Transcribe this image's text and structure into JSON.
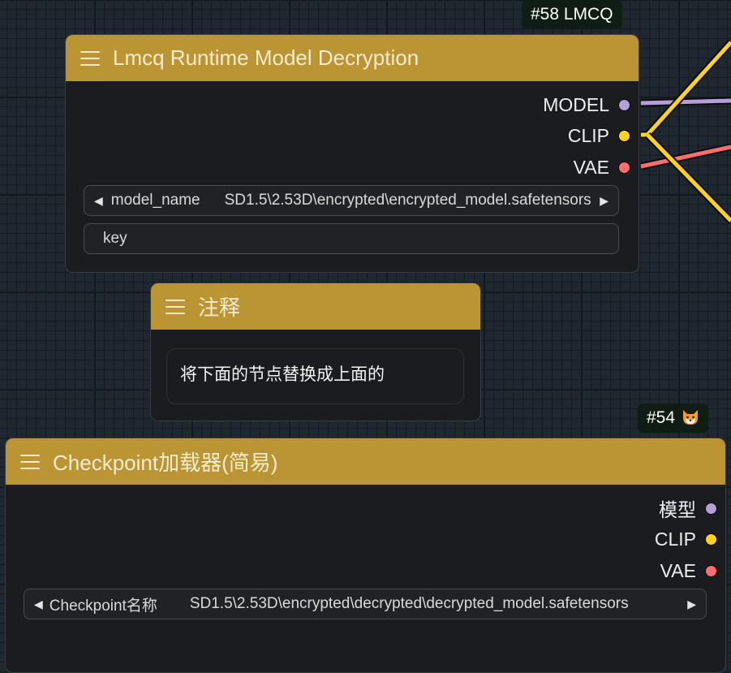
{
  "colors": {
    "header": "#bb9434",
    "node_body": "#1b1c20",
    "model_slot": "#b49fd6",
    "clip_slot": "#ffd21f",
    "vae_slot": "#ff6e6e",
    "badge_bg": "#0f1d14"
  },
  "lmcq_node": {
    "badge": "#58 LMCQ",
    "title": "Lmcq Runtime Model Decryption",
    "menu_icon": "hamburger-icon",
    "outputs": [
      {
        "label": "MODEL",
        "color": "#b49fd6"
      },
      {
        "label": "CLIP",
        "color": "#ffd21f"
      },
      {
        "label": "VAE",
        "color": "#ff6e6e"
      }
    ],
    "model_widget": {
      "label": "model_name",
      "value": "SD1.5\\2.53D\\encrypted\\encrypted_model.safetensors"
    },
    "key_widget": {
      "label": "key",
      "value": ""
    }
  },
  "note_node": {
    "title": "注释",
    "menu_icon": "hamburger-icon",
    "text": "将下面的节点替换成上面的"
  },
  "checkpoint_node": {
    "badge": "#54",
    "badge_icon": "fox-icon",
    "title": "Checkpoint加载器(简易)",
    "menu_icon": "hamburger-icon",
    "outputs": [
      {
        "label": "模型",
        "color": "#b49fd6"
      },
      {
        "label": "CLIP",
        "color": "#ffd21f"
      },
      {
        "label": "VAE",
        "color": "#ff6e6e"
      }
    ],
    "ckpt_widget": {
      "label": "Checkpoint名称",
      "value": "SD1.5\\2.53D\\encrypted\\decrypted\\decrypted_model.safetensors"
    }
  }
}
